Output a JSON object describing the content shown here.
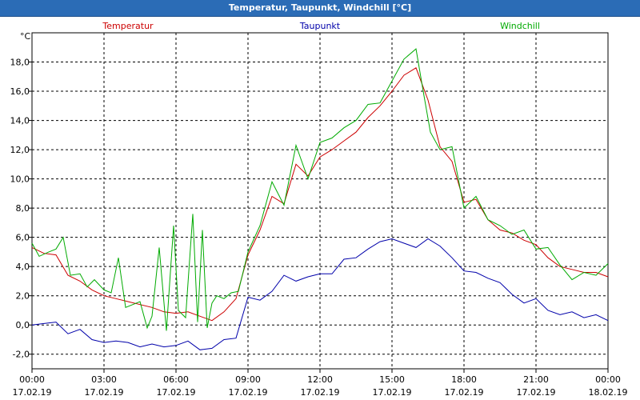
{
  "window_title": "Temperatur, Taupunkt, Windchill [°C]",
  "chart_data": {
    "type": "line",
    "title": "Temperatur, Taupunkt, Windchill [°C]",
    "ylabel": "°C",
    "ylim": [
      -3,
      20
    ],
    "xlim": [
      0,
      24
    ],
    "grid": true,
    "legend_placement": "top",
    "x_ticks": [
      {
        "time": "00:00",
        "date": "17.02.19",
        "hour": 0
      },
      {
        "time": "03:00",
        "date": "17.02.19",
        "hour": 3
      },
      {
        "time": "06:00",
        "date": "17.02.19",
        "hour": 6
      },
      {
        "time": "09:00",
        "date": "17.02.19",
        "hour": 9
      },
      {
        "time": "12:00",
        "date": "17.02.19",
        "hour": 12
      },
      {
        "time": "15:00",
        "date": "17.02.19",
        "hour": 15
      },
      {
        "time": "18:00",
        "date": "17.02.19",
        "hour": 18
      },
      {
        "time": "21:00",
        "date": "17.02.19",
        "hour": 21
      },
      {
        "time": "00:00",
        "date": "18.02.19",
        "hour": 24
      }
    ],
    "y_ticks": [
      {
        "value": -2,
        "label": "-2,0"
      },
      {
        "value": 0,
        "label": "0,0"
      },
      {
        "value": 2,
        "label": "2,0"
      },
      {
        "value": 4,
        "label": "4,0"
      },
      {
        "value": 6,
        "label": "6,0"
      },
      {
        "value": 8,
        "label": "8,0"
      },
      {
        "value": 10,
        "label": "10,0"
      },
      {
        "value": 12,
        "label": "12,0"
      },
      {
        "value": 14,
        "label": "14,0"
      },
      {
        "value": 16,
        "label": "16,0"
      },
      {
        "value": 18,
        "label": "18,0"
      }
    ],
    "series": [
      {
        "name": "Temperatur",
        "color": "#cc0000",
        "x": [
          0,
          0.5,
          1,
          1.5,
          2,
          2.5,
          3,
          3.5,
          4,
          4.5,
          5,
          5.5,
          6,
          6.5,
          7,
          7.5,
          8,
          8.5,
          9,
          9.5,
          10,
          10.5,
          11,
          11.5,
          12,
          12.5,
          13,
          13.5,
          14,
          14.5,
          15,
          15.5,
          16,
          16.5,
          17,
          17.5,
          18,
          18.5,
          19,
          19.5,
          20,
          20.5,
          21,
          21.5,
          22,
          22.5,
          23,
          23.5,
          24
        ],
        "values": [
          5.3,
          4.9,
          4.8,
          3.4,
          3.0,
          2.4,
          2.0,
          1.8,
          1.6,
          1.4,
          1.2,
          0.9,
          0.8,
          0.9,
          0.6,
          0.3,
          0.9,
          1.8,
          4.8,
          6.5,
          8.8,
          8.3,
          11.0,
          10.2,
          11.5,
          12.0,
          12.6,
          13.2,
          14.2,
          15.0,
          16.0,
          17.1,
          17.6,
          15.4,
          12.2,
          11.2,
          8.4,
          8.6,
          7.2,
          6.5,
          6.3,
          5.8,
          5.5,
          4.6,
          4.0,
          3.8,
          3.6,
          3.6,
          3.3
        ]
      },
      {
        "name": "Taupunkt",
        "color": "#0000aa",
        "x": [
          0,
          0.5,
          1,
          1.5,
          2,
          2.5,
          3,
          3.5,
          4,
          4.5,
          5,
          5.5,
          6,
          6.5,
          7,
          7.5,
          8,
          8.5,
          9,
          9.5,
          10,
          10.5,
          11,
          11.5,
          12,
          12.5,
          13,
          13.5,
          14,
          14.5,
          15,
          15.5,
          16,
          16.5,
          17,
          17.5,
          18,
          18.5,
          19,
          19.5,
          20,
          20.5,
          21,
          21.5,
          22,
          22.5,
          23,
          23.5,
          24
        ],
        "values": [
          0.0,
          0.1,
          0.2,
          -0.6,
          -0.3,
          -1.0,
          -1.2,
          -1.1,
          -1.2,
          -1.5,
          -1.3,
          -1.5,
          -1.4,
          -1.1,
          -1.7,
          -1.6,
          -1.0,
          -0.9,
          1.9,
          1.7,
          2.3,
          3.4,
          3.0,
          3.3,
          3.5,
          3.5,
          4.5,
          4.6,
          5.2,
          5.7,
          5.9,
          5.6,
          5.3,
          5.9,
          5.4,
          4.6,
          3.7,
          3.6,
          3.2,
          2.9,
          2.1,
          1.5,
          1.8,
          1.0,
          0.7,
          0.9,
          0.5,
          0.7,
          0.3
        ]
      },
      {
        "name": "Windchill",
        "color": "#00aa00",
        "x": [
          0,
          0.3,
          0.7,
          1,
          1.3,
          1.6,
          2,
          2.3,
          2.6,
          3,
          3.3,
          3.6,
          3.9,
          4.2,
          4.5,
          4.8,
          5,
          5.3,
          5.6,
          5.9,
          6.1,
          6.4,
          6.7,
          6.9,
          7.1,
          7.3,
          7.5,
          7.7,
          8,
          8.3,
          8.6,
          9,
          9.5,
          10,
          10.5,
          11,
          11.5,
          12,
          12.5,
          13,
          13.5,
          14,
          14.5,
          15,
          15.5,
          16,
          16.3,
          16.6,
          17,
          17.5,
          18,
          18.5,
          19,
          19.5,
          20,
          20.5,
          21,
          21.5,
          22,
          22.5,
          23,
          23.5,
          24
        ],
        "values": [
          5.6,
          4.7,
          5.0,
          5.2,
          6.0,
          3.4,
          3.5,
          2.6,
          3.1,
          2.4,
          2.2,
          4.6,
          1.2,
          1.4,
          1.6,
          -0.2,
          0.6,
          5.3,
          -0.4,
          6.8,
          1.0,
          0.5,
          7.6,
          0.2,
          6.5,
          -0.2,
          1.5,
          2.0,
          1.8,
          2.2,
          2.3,
          5.0,
          6.8,
          9.8,
          8.2,
          12.3,
          10.0,
          12.5,
          12.8,
          13.5,
          14.0,
          15.1,
          15.2,
          16.7,
          18.2,
          18.9,
          16.0,
          13.2,
          12.0,
          12.2,
          8.0,
          8.8,
          7.2,
          6.8,
          6.2,
          6.5,
          5.2,
          5.3,
          4.1,
          3.1,
          3.6,
          3.4,
          4.2
        ]
      }
    ]
  }
}
